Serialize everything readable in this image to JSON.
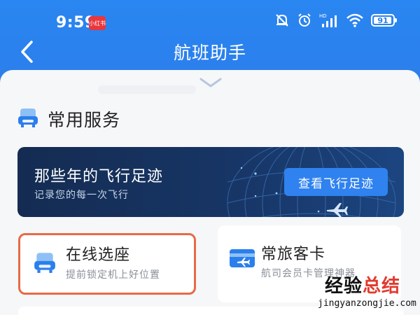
{
  "status_bar": {
    "time": "9:59",
    "app_badge": "小红书",
    "battery": "91",
    "battery_level": 0.91,
    "icons": [
      "mute-bell-icon",
      "alarm-icon",
      "hd-signal-icon",
      "wifi-icon",
      "battery-icon"
    ]
  },
  "nav": {
    "title": "航班助手",
    "back_icon": "chevron-left-icon"
  },
  "section": {
    "title": "常用服务",
    "icon": "seat-icon"
  },
  "banner": {
    "title": "那些年的飞行足迹",
    "subtitle": "记录您的每一次飞行",
    "button_label": "查看飞行足迹"
  },
  "cards": [
    {
      "title": "在线选座",
      "subtitle": "提前锁定机上好位置",
      "icon": "seat-icon",
      "highlighted": true
    },
    {
      "title": "常旅客卡",
      "subtitle": "航司会员卡管理神器",
      "icon": "plane-card-icon",
      "highlighted": false
    }
  ],
  "watermark": {
    "cn_prefix": "经验",
    "cn_suffix": "总结",
    "url": "jingyanzongjie.com"
  },
  "colors": {
    "brand_blue": "#2b7fec",
    "banner_dark": "#173565",
    "highlight": "#e86a45"
  }
}
